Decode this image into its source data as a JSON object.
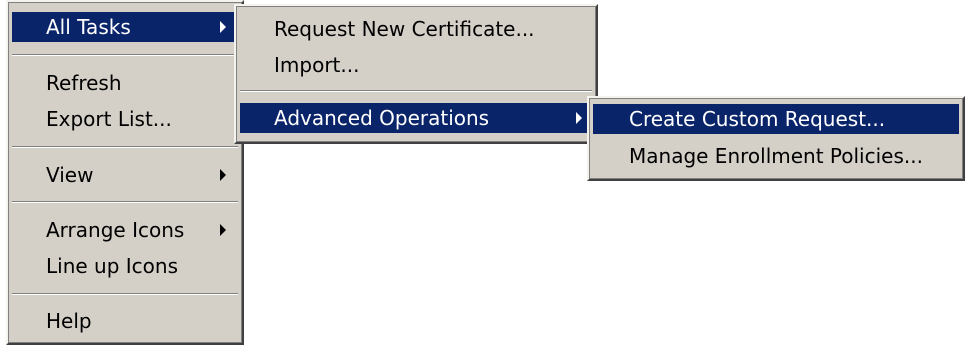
{
  "main_menu": {
    "items": [
      {
        "label": "All Tasks"
      },
      {
        "label": "Refresh"
      },
      {
        "label": "Export List..."
      },
      {
        "label": "View"
      },
      {
        "label": "Arrange Icons"
      },
      {
        "label": "Line up Icons"
      },
      {
        "label": "Help"
      }
    ]
  },
  "all_tasks_menu": {
    "items": [
      {
        "label": "Request New Certificate..."
      },
      {
        "label": "Import..."
      },
      {
        "label": "Advanced Operations"
      }
    ]
  },
  "advanced_operations_menu": {
    "items": [
      {
        "label": "Create Custom Request..."
      },
      {
        "label": "Manage Enrollment Policies..."
      }
    ]
  },
  "colors": {
    "menu_background": "#d4d0c8",
    "highlight_background": "#0a246a",
    "highlight_text": "#ffffff",
    "text": "#000000"
  },
  "icons": {
    "submenu_arrow": "triangle-right"
  }
}
